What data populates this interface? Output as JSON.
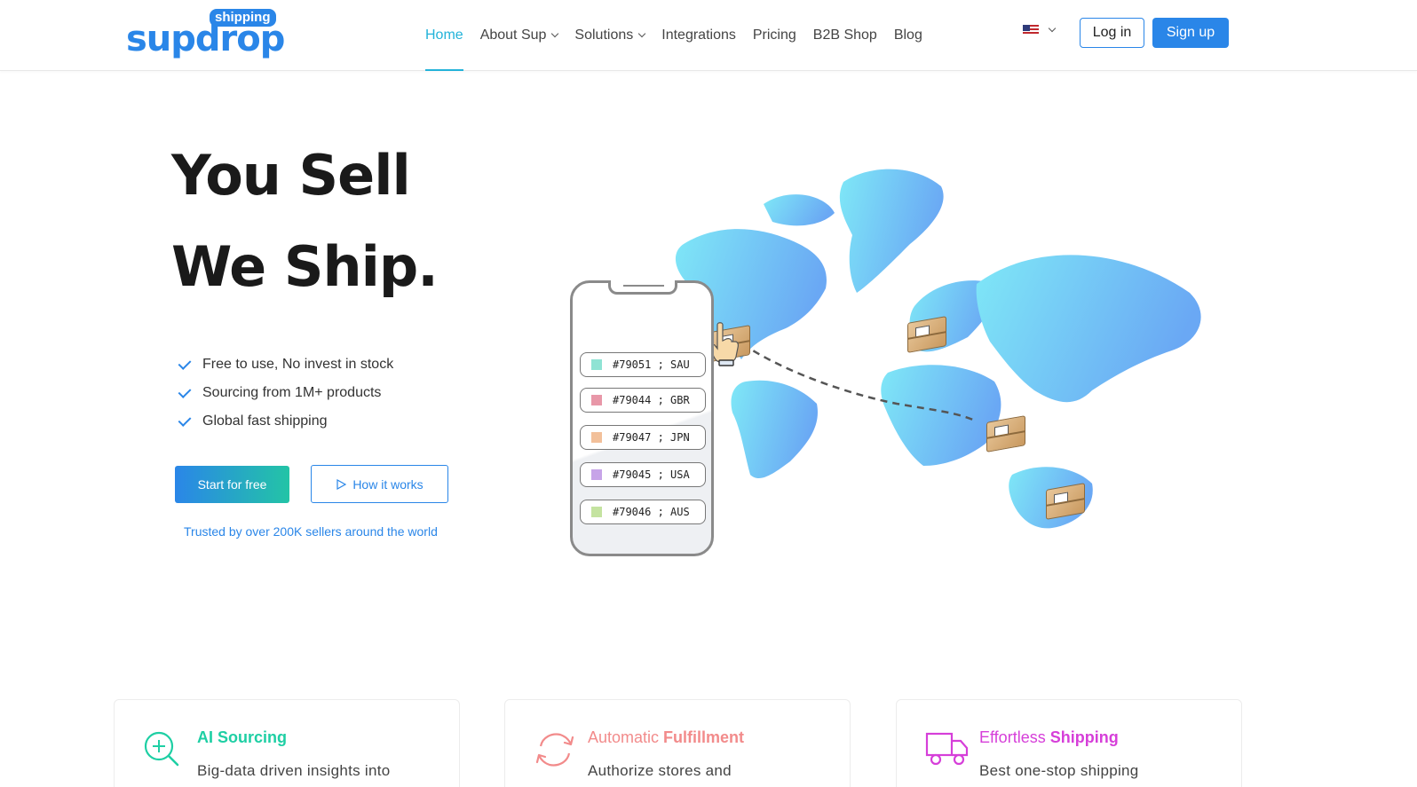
{
  "brand": {
    "logo_main": "supdrop",
    "logo_tag": "shipping",
    "primary_color": "#2a86e8",
    "active_color": "#23b3d9"
  },
  "nav": {
    "items": [
      {
        "label": "Home",
        "active": true,
        "has_dropdown": false
      },
      {
        "label": "About Sup",
        "active": false,
        "has_dropdown": true
      },
      {
        "label": "Solutions",
        "active": false,
        "has_dropdown": true
      },
      {
        "label": "Integrations",
        "active": false,
        "has_dropdown": false
      },
      {
        "label": "Pricing",
        "active": false,
        "has_dropdown": false
      },
      {
        "label": "B2B Shop",
        "active": false,
        "has_dropdown": false
      },
      {
        "label": "Blog",
        "active": false,
        "has_dropdown": false
      }
    ],
    "language_icon": "us-flag-icon",
    "login_label": "Log in",
    "signup_label": "Sign up"
  },
  "hero": {
    "title_line1": "You Sell",
    "title_line2": "We Ship.",
    "features": [
      "Free to use, No invest in stock",
      "Sourcing from 1M+ products",
      "Global fast shipping"
    ],
    "start_label": "Start for free",
    "how_label": "How it works",
    "trusted_text": "Trusted by over 200K sellers around the world"
  },
  "orders": [
    {
      "id": "#79051",
      "country": "SAU",
      "color": "#8fe3d4"
    },
    {
      "id": "#79044",
      "country": "GBR",
      "color": "#e897a8"
    },
    {
      "id": "#79047",
      "country": "JPN",
      "color": "#f2c09a"
    },
    {
      "id": "#79045",
      "country": "USA",
      "color": "#c7a4e8"
    },
    {
      "id": "#79046",
      "country": "AUS",
      "color": "#c4e3a0"
    }
  ],
  "cards": [
    {
      "title_a": "AI ",
      "title_b": "Sourcing",
      "desc": "Big-data driven insights into",
      "color": "#1ecfa4",
      "icon": "search-plus-icon"
    },
    {
      "title_a": "Automatic ",
      "title_b": "Fulfillment",
      "desc": "Authorize stores and",
      "color": "#f28b8b",
      "icon": "refresh-icon"
    },
    {
      "title_a": "Effortless ",
      "title_b": "Shipping",
      "desc": "Best one-stop shipping",
      "color": "#d63fd9",
      "icon": "truck-icon"
    }
  ]
}
